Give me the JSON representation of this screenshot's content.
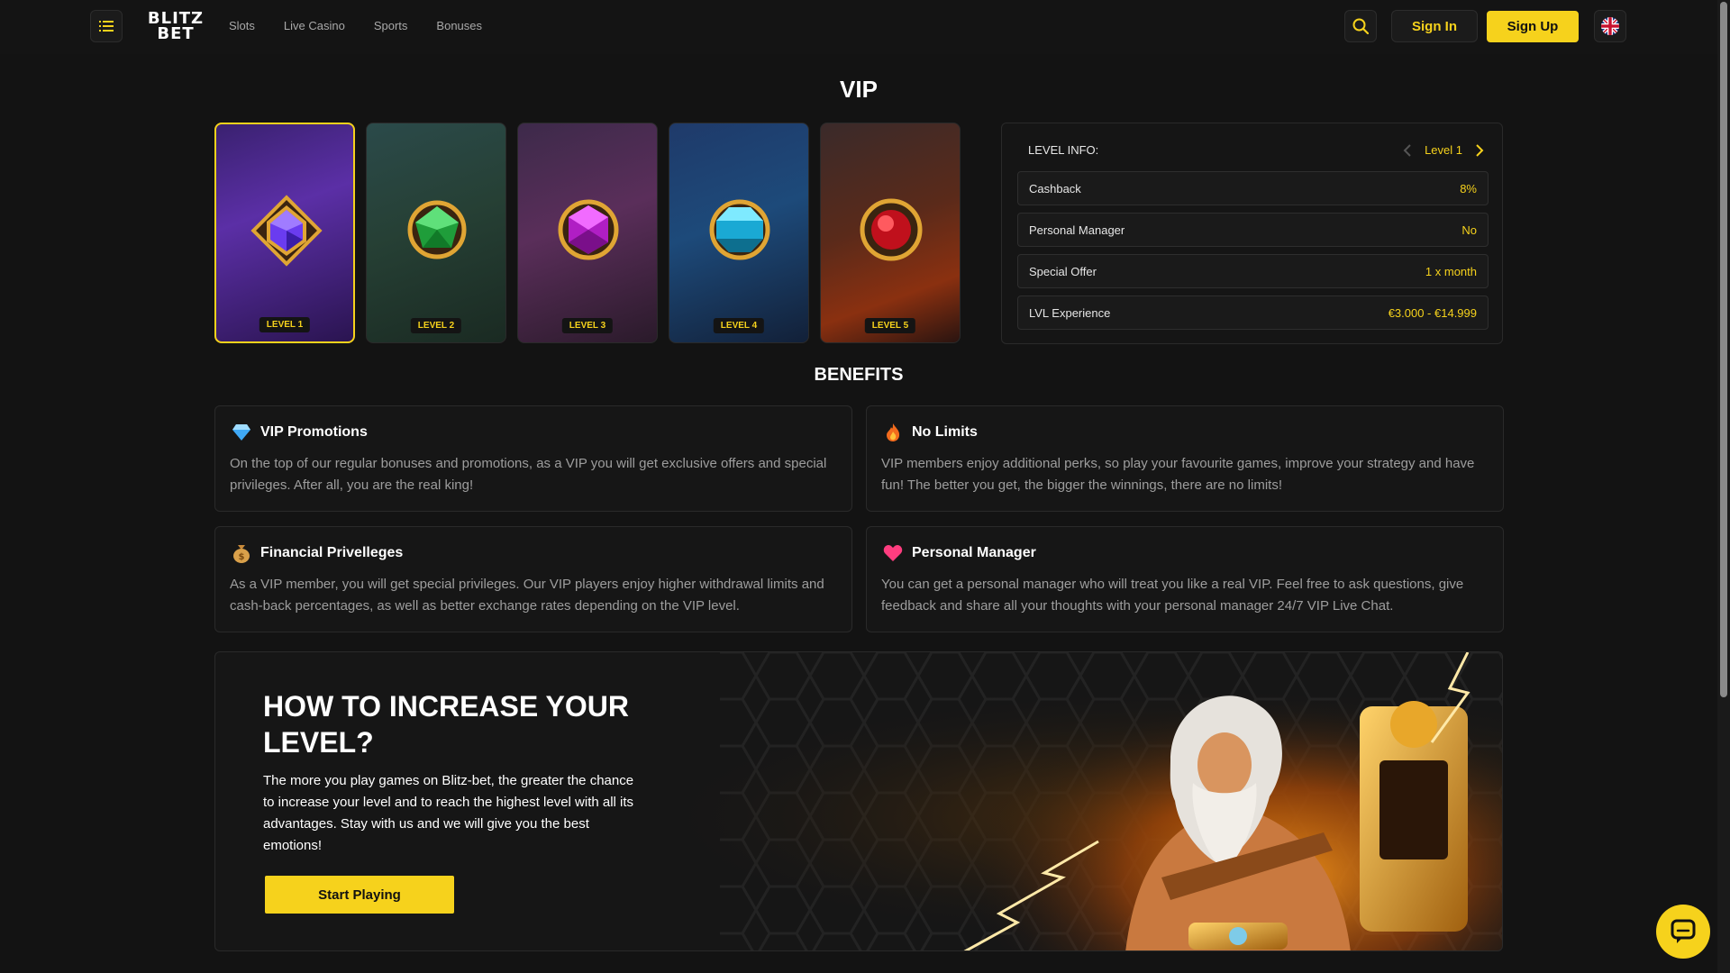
{
  "header": {
    "logo_top": "BLITZ",
    "logo_bottom": "BET",
    "nav": [
      "Slots",
      "Live Casino",
      "Sports",
      "Bonuses"
    ],
    "sign_in": "Sign In",
    "sign_up": "Sign Up"
  },
  "page_title": "VIP",
  "levels": [
    {
      "label": "LEVEL 1",
      "color": "#7b3fe0",
      "active": true
    },
    {
      "label": "LEVEL 2",
      "color": "#2fbf4a",
      "active": false
    },
    {
      "label": "LEVEL 3",
      "color": "#c026d3",
      "active": false
    },
    {
      "label": "LEVEL 4",
      "color": "#22c3e6",
      "active": false
    },
    {
      "label": "LEVEL 5",
      "color": "#e11d2e",
      "active": false
    }
  ],
  "level_info": {
    "heading": "LEVEL INFO:",
    "current": "Level 1",
    "rows": [
      {
        "key": "Cashback",
        "value": "8%"
      },
      {
        "key": "Personal Manager",
        "value": "No"
      },
      {
        "key": "Special Offer",
        "value": "1 x month"
      },
      {
        "key": "LVL Experience",
        "value": "€3.000 - €14.999"
      }
    ]
  },
  "benefits_title": "BENEFITS",
  "benefits": [
    {
      "icon": "diamond-icon",
      "title": "VIP Promotions",
      "text": "On the top of our regular bonuses and promotions, as a VIP you will get exclusive offers and special privileges. After all, you are the real king!"
    },
    {
      "icon": "fire-icon",
      "title": "No Limits",
      "text": "VIP members enjoy additional perks, so play your favourite games, improve your strategy and have fun! The better you get, the bigger the winnings, there are no limits!"
    },
    {
      "icon": "money-bag-icon",
      "title": "Financial Privelleges",
      "text": "As a VIP member, you will get special privileges. Our VIP players enjoy higher withdrawal limits and cash-back percentages, as well as better exchange rates depending on the VIP level."
    },
    {
      "icon": "heart-icon",
      "title": "Personal Manager",
      "text": "You can get a personal manager who will treat you like a real VIP. Feel free to ask questions, give feedback and share all your thoughts with your personal manager 24/7 VIP Live Chat."
    }
  ],
  "promo": {
    "title": "HOW TO INCREASE YOUR LEVEL?",
    "text": "The more you play games on Blitz-bet, the greater the chance to increase your level and to reach the highest level with all its advantages. Stay with us and we will give you the best emotions!",
    "button": "Start Playing"
  },
  "colors": {
    "accent": "#f6d21c",
    "background": "#131313"
  }
}
